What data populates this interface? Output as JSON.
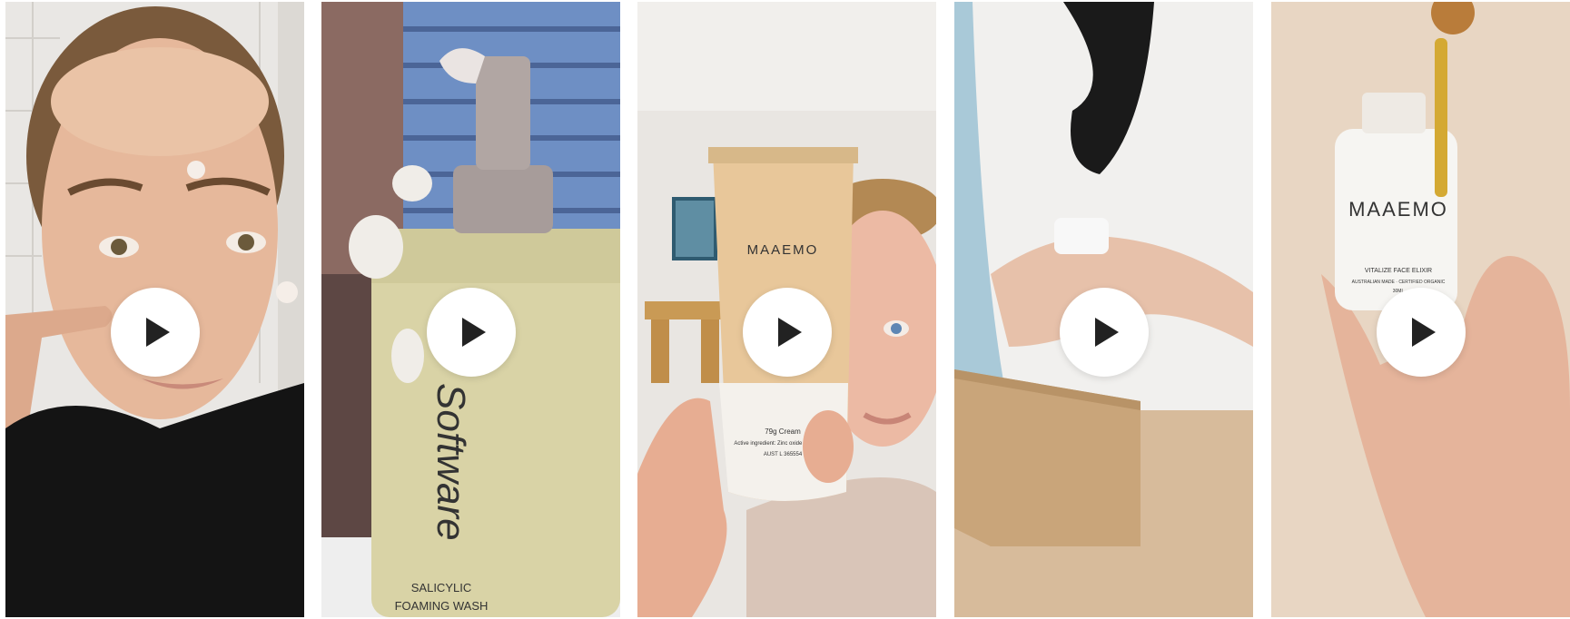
{
  "gallery": {
    "cards": [
      {
        "id": "video-1",
        "play_icon": "play-icon",
        "product_text": []
      },
      {
        "id": "video-2",
        "play_icon": "play-icon",
        "product_text": [
          "Software",
          "SALICYLIC",
          "FOAMING WASH"
        ]
      },
      {
        "id": "video-3",
        "play_icon": "play-icon",
        "product_text": [
          "MAAEMO",
          "79g Cream",
          "Active ingredient: Zinc oxide 23% (W/W)",
          "AUST L 365554"
        ]
      },
      {
        "id": "video-4",
        "play_icon": "play-icon",
        "product_text": []
      },
      {
        "id": "video-5",
        "play_icon": "play-icon",
        "product_text": [
          "MAAEMO",
          "VITALIZE FACE ELIXIR",
          "AUSTRALIAN MADE · CERTIFIED ORGANIC",
          "30ML"
        ]
      }
    ]
  },
  "colors": {
    "play_button_bg": "#ffffff",
    "play_icon": "#222222",
    "page_bg": "#ffffff"
  }
}
